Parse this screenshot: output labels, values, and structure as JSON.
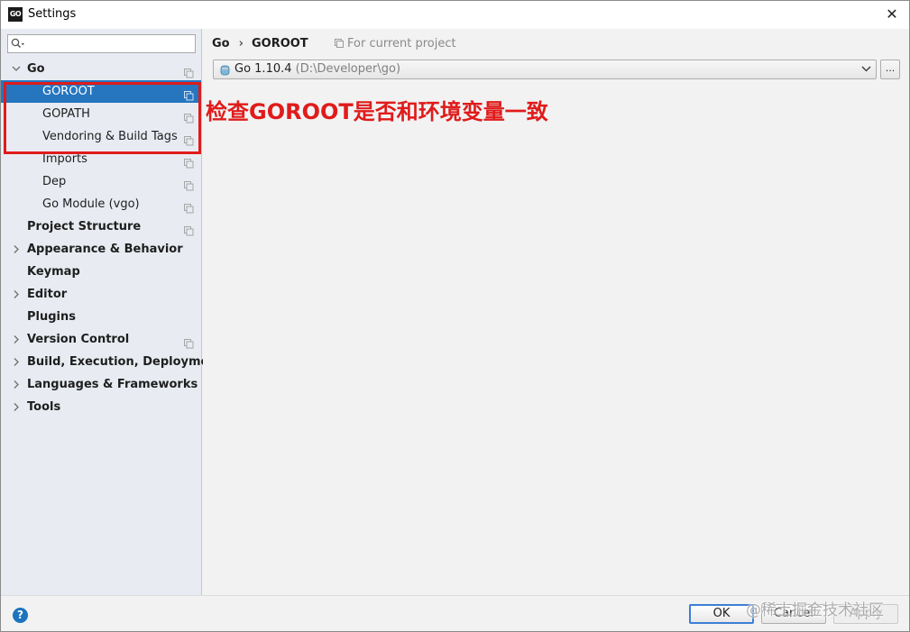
{
  "window": {
    "title": "Settings",
    "logo_text": "GO",
    "close_glyph": "✕"
  },
  "search": {
    "placeholder": "",
    "value": ""
  },
  "tree": [
    {
      "label": "Go",
      "level": 0,
      "bold": true,
      "expanded": true,
      "has_children": true,
      "project_icon": true,
      "selected": false
    },
    {
      "label": "GOROOT",
      "level": 1,
      "bold": false,
      "has_children": false,
      "project_icon": true,
      "selected": true
    },
    {
      "label": "GOPATH",
      "level": 1,
      "bold": false,
      "has_children": false,
      "project_icon": true,
      "selected": false
    },
    {
      "label": "Vendoring & Build Tags",
      "level": 1,
      "bold": false,
      "has_children": false,
      "project_icon": true,
      "selected": false
    },
    {
      "label": "Imports",
      "level": 1,
      "bold": false,
      "has_children": false,
      "project_icon": true,
      "selected": false
    },
    {
      "label": "Dep",
      "level": 1,
      "bold": false,
      "has_children": false,
      "project_icon": true,
      "selected": false
    },
    {
      "label": "Go Module (vgo)",
      "level": 1,
      "bold": false,
      "has_children": false,
      "project_icon": true,
      "selected": false
    },
    {
      "label": "Project Structure",
      "level": 0,
      "bold": true,
      "has_children": false,
      "project_icon": true,
      "selected": false
    },
    {
      "label": "Appearance & Behavior",
      "level": 0,
      "bold": true,
      "expanded": false,
      "has_children": true,
      "project_icon": false,
      "selected": false
    },
    {
      "label": "Keymap",
      "level": 0,
      "bold": true,
      "has_children": false,
      "project_icon": false,
      "selected": false
    },
    {
      "label": "Editor",
      "level": 0,
      "bold": true,
      "expanded": false,
      "has_children": true,
      "project_icon": false,
      "selected": false
    },
    {
      "label": "Plugins",
      "level": 0,
      "bold": true,
      "has_children": false,
      "project_icon": false,
      "selected": false
    },
    {
      "label": "Version Control",
      "level": 0,
      "bold": true,
      "expanded": false,
      "has_children": true,
      "project_icon": true,
      "selected": false
    },
    {
      "label": "Build, Execution, Deployment",
      "level": 0,
      "bold": true,
      "expanded": false,
      "has_children": true,
      "project_icon": false,
      "selected": false
    },
    {
      "label": "Languages & Frameworks",
      "level": 0,
      "bold": true,
      "expanded": false,
      "has_children": true,
      "project_icon": false,
      "selected": false
    },
    {
      "label": "Tools",
      "level": 0,
      "bold": true,
      "expanded": false,
      "has_children": true,
      "project_icon": false,
      "selected": false
    }
  ],
  "breadcrumb": {
    "parent": "Go",
    "separator": "›",
    "current": "GOROOT"
  },
  "scope_label": "For current project",
  "sdk": {
    "name": "Go 1.10.4",
    "path": "(D:\\Developer\\go)",
    "icon": "gopher-icon"
  },
  "browse_label": "...",
  "annotation": "检查GOROOT是否和环境变量一致",
  "footer": {
    "help": "?",
    "ok": "OK",
    "cancel": "Cancel",
    "apply": "Apply"
  },
  "watermark": "@稀土掘金技术社区",
  "colors": {
    "selection": "#2675bf",
    "annotation": "#e01b1b",
    "sidebar_bg": "#e8ecf2",
    "ok_border": "#3d7fd6"
  }
}
